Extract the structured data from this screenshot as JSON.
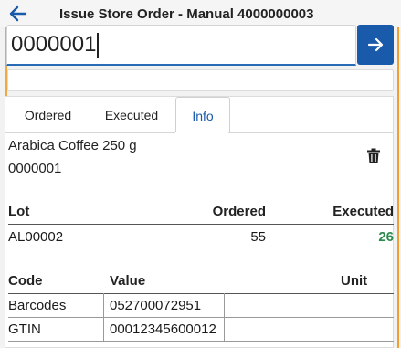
{
  "header": {
    "title": "Issue Store Order - Manual 4000000003",
    "back_icon": "arrow-left-icon"
  },
  "scan": {
    "value": "0000001",
    "go_icon": "arrow-right-icon"
  },
  "colors": {
    "accent": "#1a5aaa",
    "executed_value": "#2a8a4a",
    "decor_line": "#f0a030"
  },
  "tabs": [
    {
      "label": "Ordered",
      "active": false
    },
    {
      "label": "Executed",
      "active": false
    },
    {
      "label": "Info",
      "active": true
    }
  ],
  "product": {
    "name": "Arabica Coffee 250 g",
    "code": "0000001",
    "delete_icon": "trash-icon"
  },
  "lots_table": {
    "headers": {
      "lot": "Lot",
      "ordered": "Ordered",
      "executed": "Executed"
    },
    "rows": [
      {
        "lot": "AL00002",
        "ordered": "55",
        "executed": "26"
      }
    ]
  },
  "codes_table": {
    "headers": {
      "code": "Code",
      "value": "Value",
      "unit": "Unit"
    },
    "rows": [
      {
        "code": "Barcodes",
        "value": "052700072951",
        "unit": ""
      },
      {
        "code": "GTIN",
        "value": "00012345600012",
        "unit": ""
      }
    ]
  }
}
